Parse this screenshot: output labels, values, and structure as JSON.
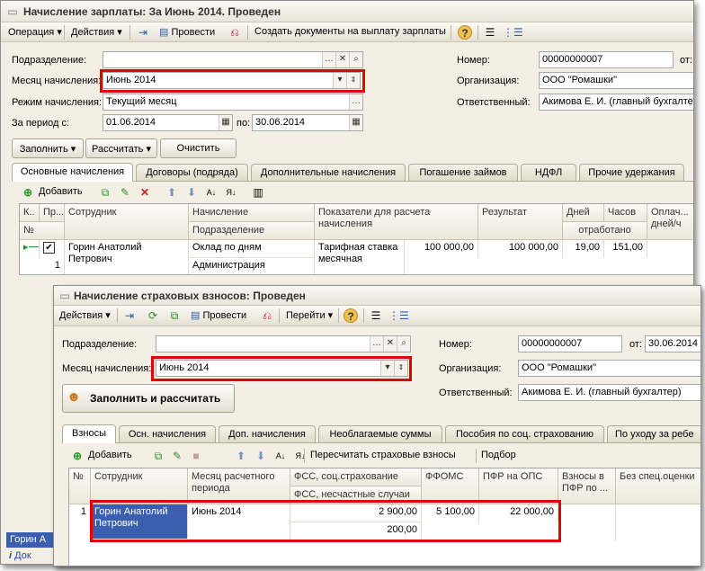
{
  "back": {
    "title": "Начисление зарплаты: За Июнь 2014. Проведен",
    "toolbar": {
      "operation": "Операция",
      "actions": "Действия",
      "post": "Провести",
      "create_docs": "Создать документы на выплату зарплаты"
    },
    "form": {
      "division_label": "Подразделение:",
      "month_label": "Месяц начисления:",
      "month_value": "Июнь 2014",
      "mode_label": "Режим начисления:",
      "mode_value": "Текущий месяц",
      "period_label": "За период с:",
      "period_from": "01.06.2014",
      "period_to_label": "по:",
      "period_to": "30.06.2014",
      "number_label": "Номер:",
      "number_value": "00000000007",
      "date_label": "от:",
      "org_label": "Организация:",
      "org_value": "ООО \"Ромашки\"",
      "resp_label": "Ответственный:",
      "resp_value": "Акимова Е. И. (главный бухгалтер)"
    },
    "buttons": {
      "fill": "Заполнить",
      "calc": "Рассчитать",
      "clear": "Очистить"
    },
    "tabs": [
      "Основные начисления",
      "Договоры (подряда)",
      "Дополнительные начисления",
      "Погашение займов",
      "НДФЛ",
      "Прочие удержания"
    ],
    "grid_toolbar": {
      "add": "Добавить"
    },
    "columns": {
      "k": "К..",
      "pr": "Пр...",
      "no": "№",
      "employee": "Сотрудник",
      "accrual": "Начисление",
      "division": "Подразделение",
      "indicators": "Показатели для расчета начисления",
      "result": "Результат",
      "days": "Дней",
      "hours": "Часов",
      "worked": "отработано",
      "paid": "Оплач... дней/ч"
    },
    "row": {
      "no": "1",
      "employee": "Горин Анатолий Петрович",
      "accrual": "Оклад по дням",
      "division": "Администрация",
      "indicator": "Тарифная ставка месячная",
      "indicator_value": "100 000,00",
      "result": "100 000,00",
      "days": "19,00",
      "hours": "151,00"
    },
    "bottom_left": "Горин А",
    "bottom_left2": "Док"
  },
  "front": {
    "title": "Начисление страховых взносов: Проведен",
    "toolbar": {
      "actions": "Действия",
      "post": "Провести",
      "goto": "Перейти"
    },
    "form": {
      "division_label": "Подразделение:",
      "month_label": "Месяц начисления:",
      "month_value": "Июнь 2014",
      "number_label": "Номер:",
      "number_value": "00000000007",
      "date_label": "от:",
      "date_value": "30.06.2014",
      "org_label": "Организация:",
      "org_value": "ООО \"Ромашки\"",
      "resp_label": "Ответственный:",
      "resp_value": "Акимова Е. И. (главный бухгалтер)"
    },
    "fill_calc": "Заполнить и рассчитать",
    "tabs": [
      "Взносы",
      "Осн. начисления",
      "Доп. начисления",
      "Необлагаемые суммы",
      "Пособия по соц. страхованию",
      "По уходу за ребе"
    ],
    "grid_toolbar": {
      "add": "Добавить",
      "recalc": "Пересчитать страховые взносы",
      "pick": "Подбор"
    },
    "columns": {
      "no": "№",
      "employee": "Сотрудник",
      "month": "Месяц расчетного периода",
      "fss": "ФСС, соц.страхование",
      "fss_ns": "ФСС, несчастные случаи",
      "ffoms": "ФФОМС",
      "pfr": "ПФР на ОПС",
      "pfr_extra": "Взносы в ПФР по ...",
      "no_spec": "Без спец.оценки"
    },
    "row": {
      "no": "1",
      "employee": "Горин Анатолий Петрович",
      "month": "Июнь 2014",
      "fss": "2 900,00",
      "fss_ns": "200,00",
      "ffoms": "5 100,00",
      "pfr": "22 000,00"
    }
  },
  "colors": {
    "highlight": "#e0000a",
    "selection": "#3a5fb0"
  }
}
